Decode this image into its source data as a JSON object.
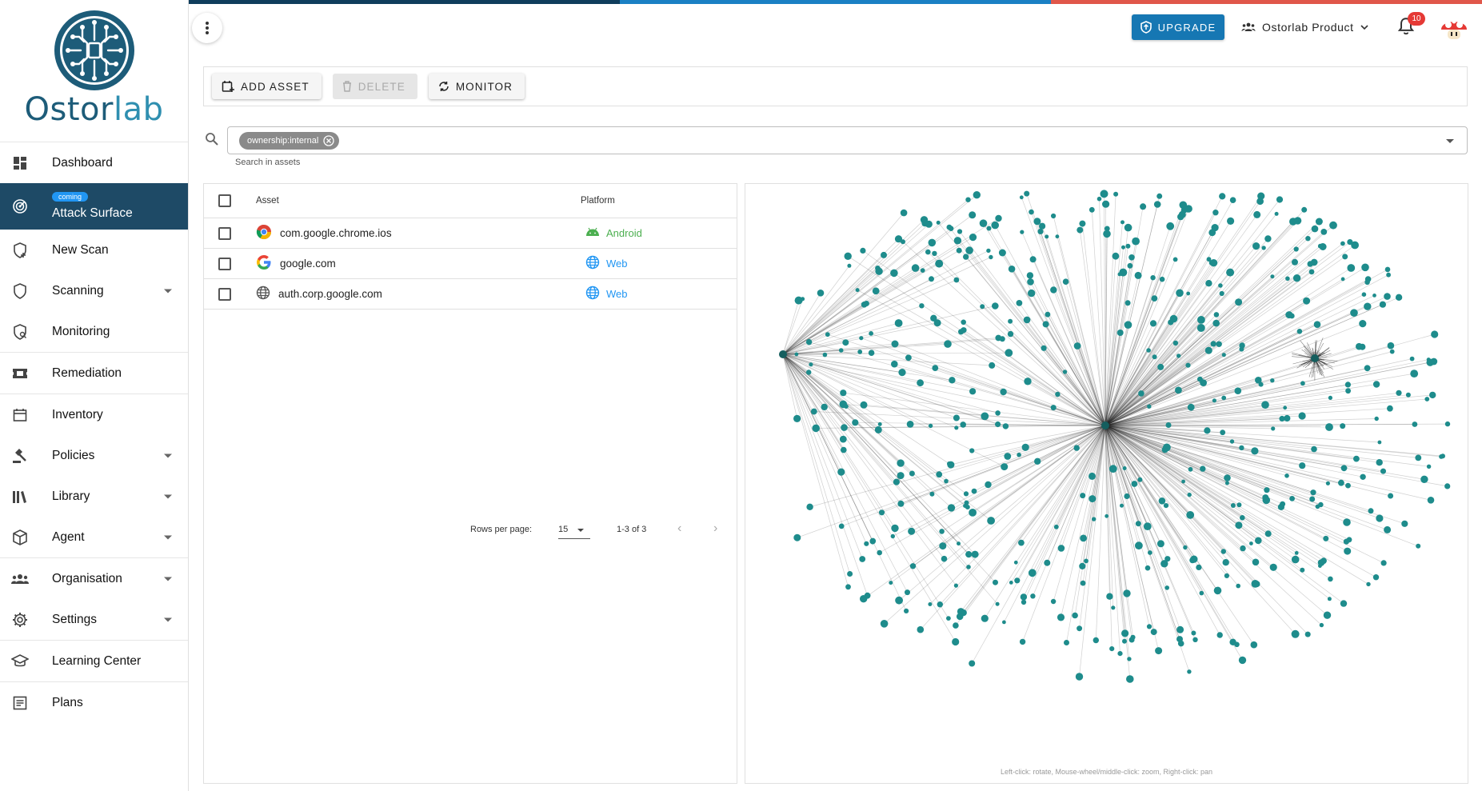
{
  "colors": {
    "bar1": "#0f3d5c",
    "bar2": "#1a80c4",
    "bar3": "#e0574a",
    "accent": "#1677b3",
    "node": "#1e8c8c",
    "active_nav": "#1e4a66"
  },
  "logo": {
    "prefix": "Ostor",
    "suffix": "lab"
  },
  "sidebar": {
    "items": [
      {
        "label": "Dashboard",
        "icon": "dashboard-icon"
      },
      {
        "label": "Attack Surface",
        "icon": "radar-icon",
        "badge": "coming",
        "active": true
      },
      {
        "label": "New Scan",
        "icon": "shield-plus-icon"
      },
      {
        "label": "Scanning",
        "icon": "shield-icon",
        "expandable": true
      },
      {
        "label": "Monitoring",
        "icon": "shield-search-icon"
      },
      {
        "label": "Remediation",
        "icon": "ticket-icon"
      },
      {
        "label": "Inventory",
        "icon": "calendar-icon"
      },
      {
        "label": "Policies",
        "icon": "gavel-icon",
        "expandable": true
      },
      {
        "label": "Library",
        "icon": "library-icon",
        "expandable": true
      },
      {
        "label": "Agent",
        "icon": "cube-icon",
        "expandable": true
      },
      {
        "label": "Organisation",
        "icon": "people-icon",
        "expandable": true
      },
      {
        "label": "Settings",
        "icon": "gear-icon",
        "expandable": true
      },
      {
        "label": "Learning Center",
        "icon": "graduation-cap-icon"
      },
      {
        "label": "Plans",
        "icon": "list-icon"
      }
    ]
  },
  "header": {
    "upgrade_label": "UPGRADE",
    "org_name": "Ostorlab Product",
    "notification_count": "10"
  },
  "toolbar": {
    "add_label": "ADD ASSET",
    "delete_label": "DELETE",
    "monitor_label": "MONITOR"
  },
  "search": {
    "chip": "ownership:internal",
    "helper": "Search in assets"
  },
  "table": {
    "headers": {
      "asset": "Asset",
      "platform": "Platform"
    },
    "rows": [
      {
        "asset": "com.google.chrome.ios",
        "asset_icon": "chrome-icon",
        "platform": "Android",
        "platform_icon": "android-icon",
        "platform_color": "#4caf50"
      },
      {
        "asset": "google.com",
        "asset_icon": "google-icon",
        "platform": "Web",
        "platform_icon": "globe-icon",
        "platform_color": "#2196f3"
      },
      {
        "asset": "auth.corp.google.com",
        "asset_icon": "globe-icon",
        "platform": "Web",
        "platform_icon": "globe-icon",
        "platform_color": "#2196f3"
      }
    ],
    "pagination": {
      "rows_per_page_label": "Rows per page:",
      "rows_per_page": "15",
      "range": "1-3 of 3"
    }
  },
  "graph": {
    "hint": "Left-click: rotate, Mouse-wheel/middle-click: zoom, Right-click: pan"
  }
}
